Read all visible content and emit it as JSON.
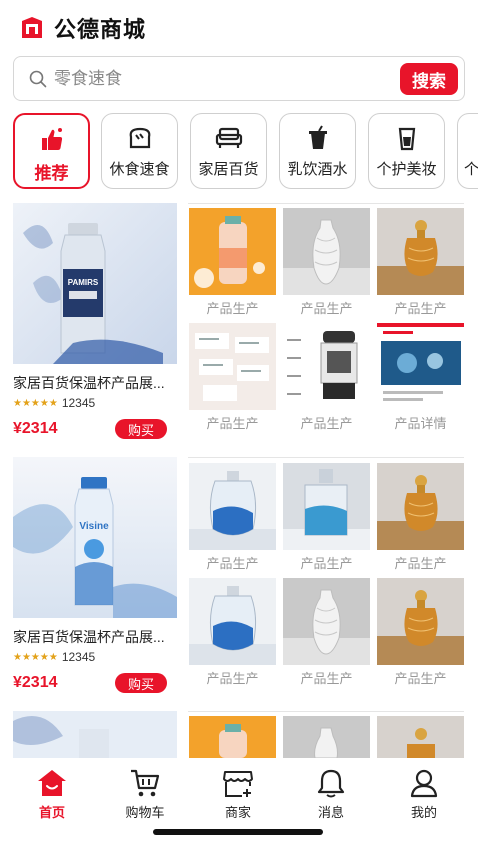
{
  "header": {
    "title": "公德商城",
    "logo_icon": "shop-logo-icon"
  },
  "search": {
    "placeholder": "零食速食",
    "button_label": "搜索"
  },
  "categories": [
    {
      "label": "推荐",
      "icon": "thumbs-up-icon",
      "active": true
    },
    {
      "label": "休食速食",
      "icon": "bread-icon",
      "active": false
    },
    {
      "label": "家居百货",
      "icon": "sofa-icon",
      "active": false
    },
    {
      "label": "乳饮酒水",
      "icon": "drink-cup-icon",
      "active": false
    },
    {
      "label": "个护美妆",
      "icon": "lotion-icon",
      "active": false
    },
    {
      "label": "个",
      "icon": "",
      "active": false
    }
  ],
  "products": [
    {
      "name": "家居百货保温杯产品展...",
      "stars": "★★★★★",
      "rating_count": "12345",
      "price": "¥2314",
      "buy_label": "购买",
      "thumbs": [
        {
          "label": "产品生产",
          "art": "orange-bottle"
        },
        {
          "label": "产品生产",
          "art": "white-vase"
        },
        {
          "label": "产品生产",
          "art": "amber-perfume"
        },
        {
          "label": "产品生产",
          "art": "doc-sheet"
        },
        {
          "label": "产品生产",
          "art": "appliance"
        },
        {
          "label": "产品详情",
          "art": "detail-page"
        }
      ]
    },
    {
      "name": "家居百货保温杯产品展...",
      "stars": "★★★★★",
      "rating_count": "12345",
      "price": "¥2314",
      "buy_label": "购买",
      "thumbs": [
        {
          "label": "产品生产",
          "art": "blue-glass"
        },
        {
          "label": "产品生产",
          "art": "wave-glass"
        },
        {
          "label": "产品生产",
          "art": "amber-perfume"
        },
        {
          "label": "产品生产",
          "art": "blue-glass"
        },
        {
          "label": "产品生产",
          "art": "white-vase"
        },
        {
          "label": "产品生产",
          "art": "amber-perfume"
        }
      ]
    }
  ],
  "product_images": {
    "p1_brand": "PAMIRS",
    "p2_brand": "Visine"
  },
  "nav": [
    {
      "label": "首页",
      "icon": "home-icon",
      "active": true
    },
    {
      "label": "购物车",
      "icon": "cart-icon",
      "active": false
    },
    {
      "label": "商家",
      "icon": "store-icon",
      "active": false
    },
    {
      "label": "消息",
      "icon": "bell-icon",
      "active": false
    },
    {
      "label": "我的",
      "icon": "user-icon",
      "active": false
    }
  ],
  "colors": {
    "accent": "#e8142a",
    "star": "#e3a21a"
  }
}
